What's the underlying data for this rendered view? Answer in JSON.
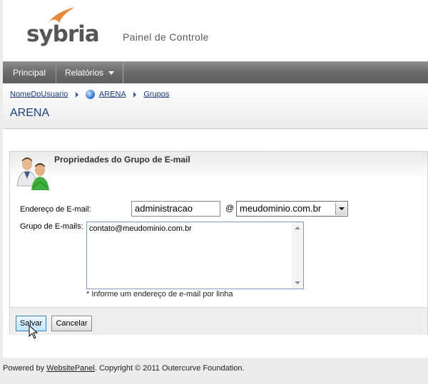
{
  "header": {
    "logo_text": "sybria",
    "title": "Painel de Controle"
  },
  "nav": {
    "items": [
      {
        "label": "Principal"
      },
      {
        "label": "Relatórios"
      }
    ]
  },
  "breadcrumb": {
    "items": [
      "NomeDoUsuario",
      "ARENA",
      "Grupos"
    ]
  },
  "page_title": "ARENA",
  "panel": {
    "title": "Propriedades do Grupo de E-mail",
    "email_label": "Endereço de E-mail:",
    "email_value": "administracao",
    "at": "@",
    "domain_selected": "meudominio.com.br",
    "group_label": "Grupo de E-mails:",
    "group_value": "contato@meudominio.com.br",
    "hint": "* Informe um endereço de e-mail por linha",
    "save_label": "Salvar",
    "cancel_label": "Cancelar"
  },
  "footer": {
    "prefix": "Powered by ",
    "link": "WebsitePanel",
    "suffix": ". Copyright © 2011 Outercurve Foundation."
  },
  "colors": {
    "accent_orange": "#e8893a",
    "link_blue": "#1a3c7c",
    "nav_gray": "#6e6e6e",
    "save_button_blue": "#bee6fd"
  }
}
